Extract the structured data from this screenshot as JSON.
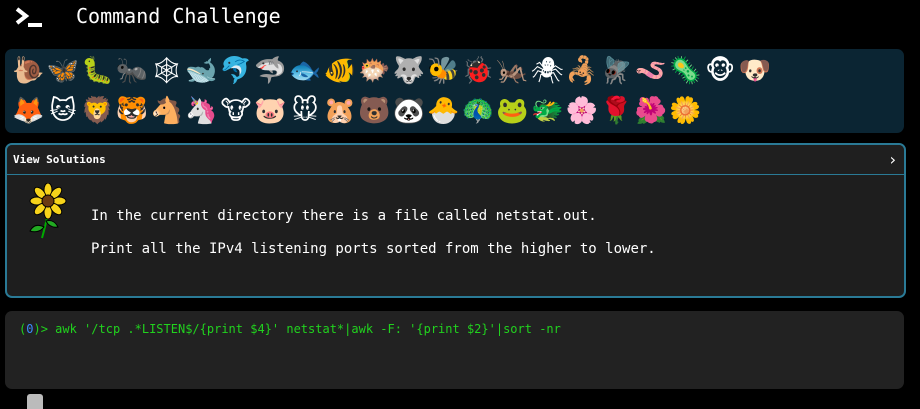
{
  "header": {
    "title": "Command Challenge",
    "logo_icon": "terminal-prompt-icon"
  },
  "icon_grid": {
    "row1": [
      {
        "name": "snail",
        "glyph": "🐌"
      },
      {
        "name": "butterfly",
        "glyph": "🦋"
      },
      {
        "name": "caterpillar",
        "glyph": "🐛"
      },
      {
        "name": "ant",
        "glyph": "🐜"
      },
      {
        "name": "spider-web",
        "glyph": "🕸"
      },
      {
        "name": "whale",
        "glyph": "🐋"
      },
      {
        "name": "dolphin",
        "glyph": "🐬"
      },
      {
        "name": "shark",
        "glyph": "🦈"
      },
      {
        "name": "fish",
        "glyph": "🐟"
      },
      {
        "name": "tropical-fish",
        "glyph": "🐠"
      },
      {
        "name": "blowfish",
        "glyph": "🐡"
      },
      {
        "name": "wolf",
        "glyph": "🐺"
      },
      {
        "name": "bee",
        "glyph": "🐝"
      },
      {
        "name": "ladybug",
        "glyph": "🐞"
      },
      {
        "name": "cricket",
        "glyph": "🦗"
      },
      {
        "name": "spider",
        "glyph": "🕷"
      },
      {
        "name": "scorpion",
        "glyph": "🦂"
      },
      {
        "name": "fly",
        "glyph": "🪰"
      },
      {
        "name": "worm",
        "glyph": "🪱"
      },
      {
        "name": "microbe",
        "glyph": "🦠"
      },
      {
        "name": "monkey",
        "glyph": "🐵"
      },
      {
        "name": "dog",
        "glyph": "🐶"
      }
    ],
    "row2": [
      {
        "name": "fox",
        "glyph": "🦊"
      },
      {
        "name": "cat",
        "glyph": "🐱"
      },
      {
        "name": "lion",
        "glyph": "🦁"
      },
      {
        "name": "tiger",
        "glyph": "🐯"
      },
      {
        "name": "horse",
        "glyph": "🐴"
      },
      {
        "name": "unicorn",
        "glyph": "🦄"
      },
      {
        "name": "cow",
        "glyph": "🐮"
      },
      {
        "name": "pig",
        "glyph": "🐷"
      },
      {
        "name": "mouse",
        "glyph": "🐭"
      },
      {
        "name": "hamster",
        "glyph": "🐹"
      },
      {
        "name": "bear",
        "glyph": "🐻"
      },
      {
        "name": "panda",
        "glyph": "🐼"
      },
      {
        "name": "hatching-chick",
        "glyph": "🐣"
      },
      {
        "name": "peacock",
        "glyph": "🦚"
      },
      {
        "name": "frog",
        "glyph": "🐸"
      },
      {
        "name": "dragon",
        "glyph": "🐲"
      },
      {
        "name": "cherry-blossom",
        "glyph": "🌸"
      },
      {
        "name": "rose",
        "glyph": "🌹"
      },
      {
        "name": "hibiscus",
        "glyph": "🌺"
      },
      {
        "name": "blossom",
        "glyph": "🌼"
      }
    ]
  },
  "challenge": {
    "view_solutions_label": "View Solutions",
    "chevron": "›",
    "line1": "In the current directory there is a file called netstat.out.",
    "line2": "Print all the IPv4 listening ports sorted from the higher to lower."
  },
  "terminal": {
    "prompt_open": "(",
    "prompt_zero": "0",
    "prompt_close": ")> ",
    "command": "awk '/tcp .*LISTEN$/{print $4}' netstat*|awk -F: '{print $2}'|sort -nr"
  },
  "colors": {
    "background": "#000000",
    "icon_panel": "#0b2533",
    "card_border": "#2a7a96",
    "terminal_text": "#21d21e"
  }
}
